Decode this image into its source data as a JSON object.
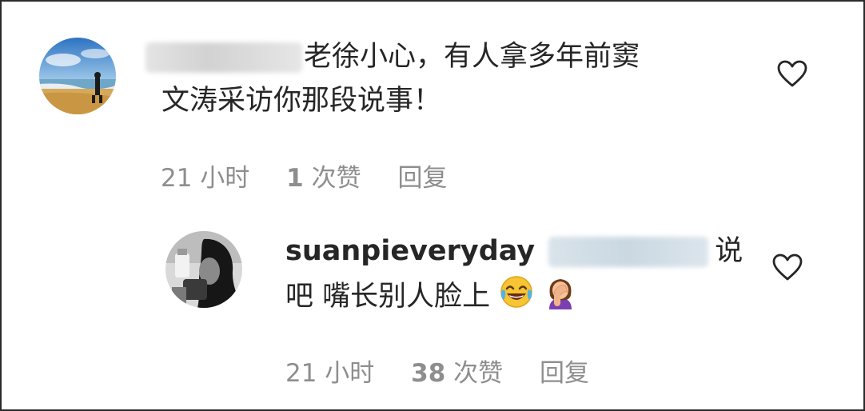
{
  "comments": [
    {
      "text_line1": "老徐小心，有人拿多年前窦",
      "text_line2": "文涛采访你那段说事！",
      "time": "21 小时",
      "likes_count": "1",
      "likes_label": "次赞",
      "reply_label": "回复"
    },
    {
      "username": "suanpieveryday",
      "text_after_mention": "说",
      "text_line2": "吧 嘴长别人脸上",
      "emojis": [
        "face-with-tears-of-joy-emoji",
        "woman-facepalming-emoji"
      ],
      "time": "21 小时",
      "likes_count": "38",
      "likes_label": "次赞",
      "reply_label": "回复"
    }
  ]
}
